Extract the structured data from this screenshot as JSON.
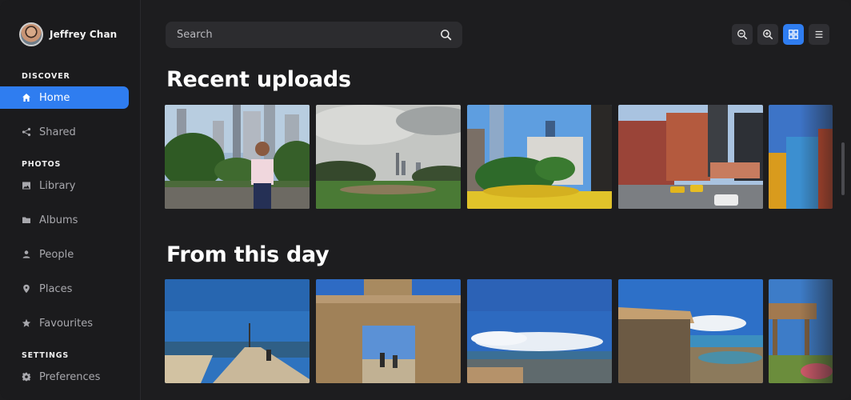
{
  "profile": {
    "name": "Jeffrey Chan"
  },
  "sidebar": {
    "sections": [
      {
        "title": "DISCOVER"
      },
      {
        "title": "PHOTOS"
      },
      {
        "title": "SETTINGS"
      }
    ],
    "items": [
      {
        "label": "Home",
        "icon": "home-icon",
        "active": true
      },
      {
        "label": "Shared",
        "icon": "share-icon"
      },
      {
        "label": "Library",
        "icon": "image-icon"
      },
      {
        "label": "Albums",
        "icon": "folder-icon"
      },
      {
        "label": "People",
        "icon": "person-icon"
      },
      {
        "label": "Places",
        "icon": "location-pin-icon"
      },
      {
        "label": "Favourites",
        "icon": "star-icon"
      },
      {
        "label": "Preferences",
        "icon": "gear-icon"
      }
    ]
  },
  "search": {
    "placeholder": "Search"
  },
  "toolbar": [
    "zoom-out-icon",
    "zoom-in-icon",
    "grid-view-icon",
    "list-view-icon"
  ],
  "sections": [
    {
      "title": "Recent uploads"
    },
    {
      "title": "From this day"
    }
  ],
  "colors": {
    "accent": "#2f7df0",
    "background": "#1d1d1f",
    "sidebar": "#1b1b1d",
    "surface": "#2c2c2f"
  }
}
